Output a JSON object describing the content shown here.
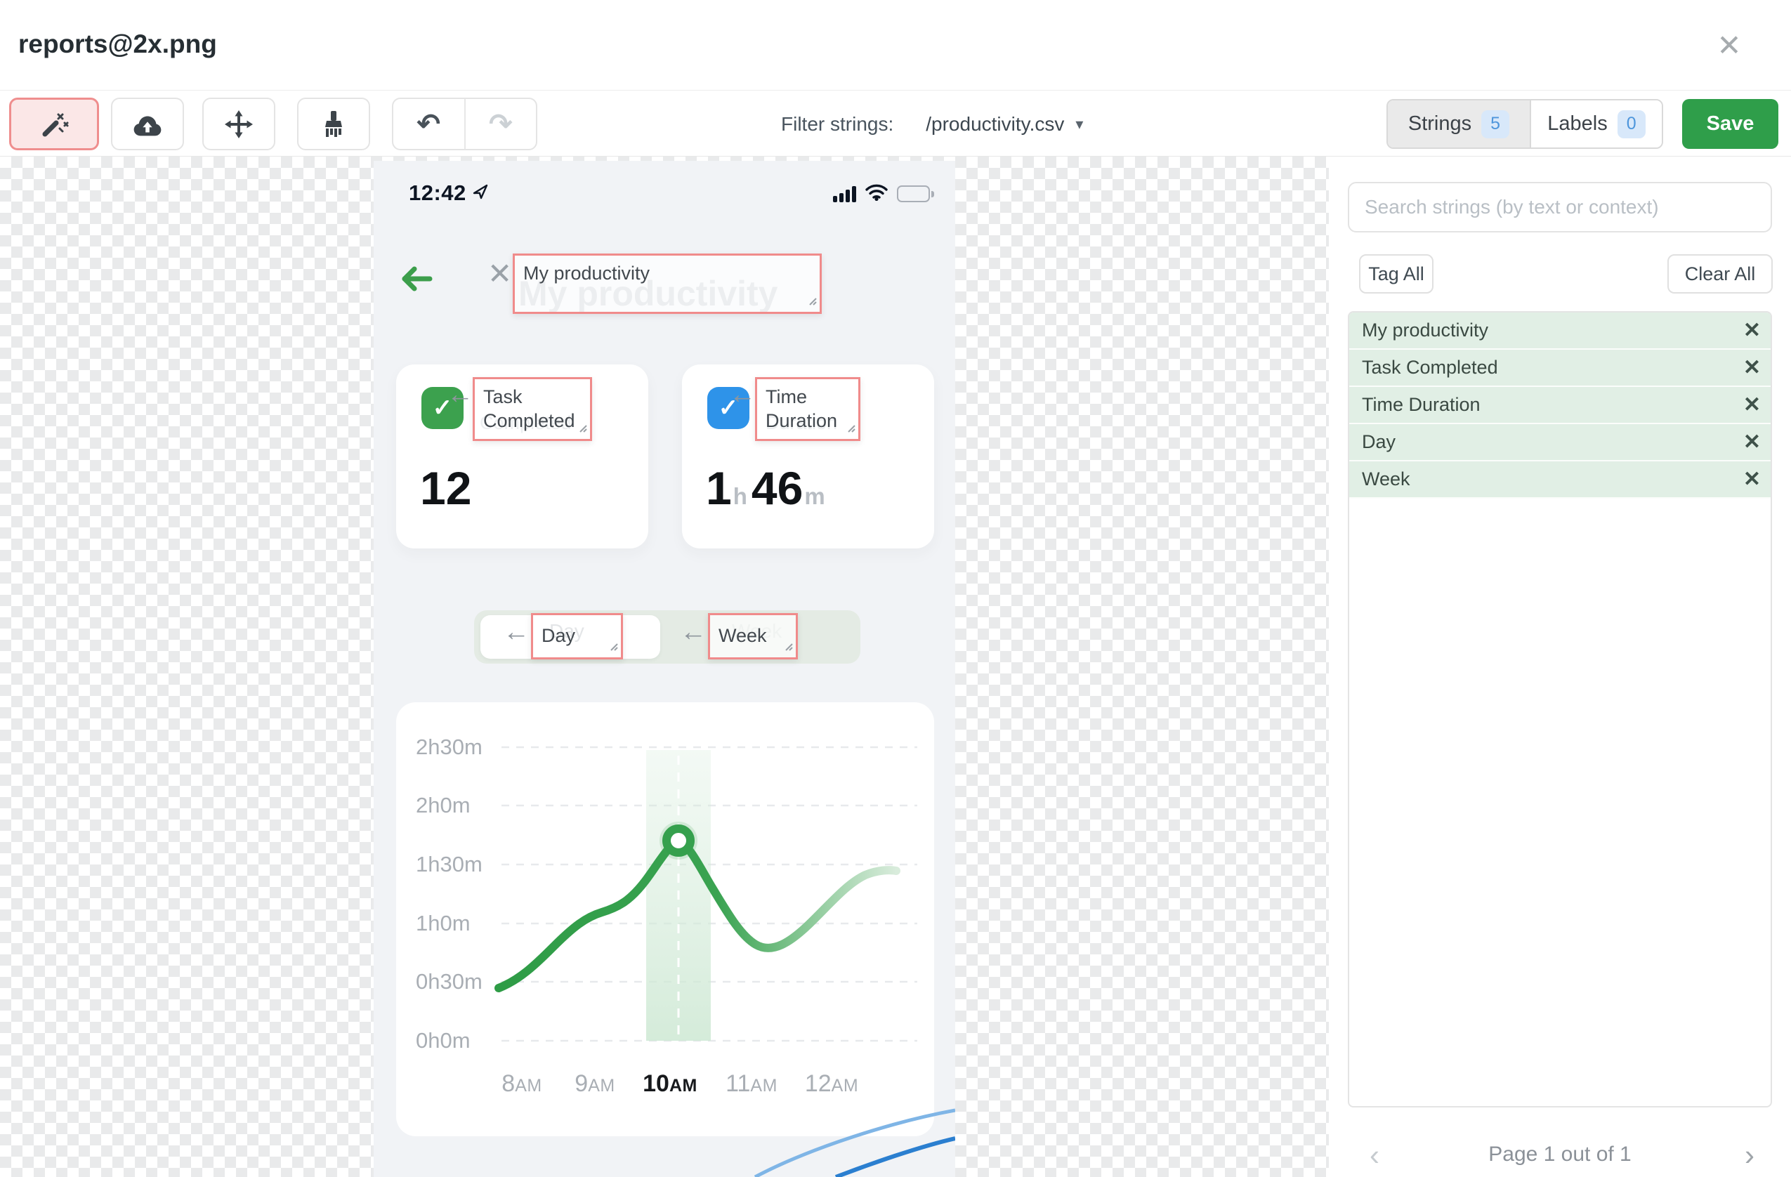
{
  "header": {
    "title": "reports@2x.png"
  },
  "toolbar": {
    "filter_label": "Filter strings:",
    "filter_value": "/productivity.csv",
    "strings_tab": "Strings",
    "strings_count": "5",
    "labels_tab": "Labels",
    "labels_count": "0",
    "save": "Save"
  },
  "icons": {
    "close": "✕",
    "tag_close": "✕",
    "anchor_arrow": "←",
    "caret_down": "▾",
    "check": "✓",
    "chevron_left": "‹",
    "chevron_right": "›",
    "undo": "↶",
    "redo": "↷"
  },
  "phone": {
    "time": "12:42",
    "ghost_title": "My productivity",
    "ghost_task": "Completed",
    "ghost_time": "Duration",
    "ghost_day": "Day",
    "ghost_week": "Week",
    "task_value": "12",
    "time_h": "1",
    "time_h_unit": "h",
    "time_m": "46",
    "time_m_unit": "m"
  },
  "tags": {
    "title": "My productivity",
    "task_line1": "Task",
    "task_line2": "Completed",
    "time_line1": "Time",
    "time_line2": "Duration",
    "day": "Day",
    "week": "Week"
  },
  "chart_data": {
    "type": "line",
    "title": "",
    "categories": [
      "8AM",
      "9AM",
      "10AM",
      "11AM",
      "12AM"
    ],
    "x_ticks": [
      {
        "t": "8",
        "p": "AM"
      },
      {
        "t": "9",
        "p": "AM"
      },
      {
        "t": "10",
        "p": "AM"
      },
      {
        "t": "11",
        "p": "AM"
      },
      {
        "t": "12",
        "p": "AM"
      }
    ],
    "y_ticks": [
      "2h30m",
      "2h0m",
      "1h30m",
      "1h0m",
      "0h30m",
      "0h0m"
    ],
    "series": [
      {
        "name": "Time Duration",
        "values_minutes": [
          28,
          65,
          102,
          55,
          90
        ]
      }
    ],
    "highlighted_x": "10AM",
    "highlight_value": "1h 46m",
    "ylim_minutes": [
      0,
      150
    ],
    "grid": "dashed-horizontal",
    "legend": "none",
    "accent_color": "#2f9e47"
  },
  "sidebar": {
    "search_placeholder": "Search strings (by text or context)",
    "tag_all": "Tag All",
    "clear_all": "Clear All",
    "strings": [
      "My productivity",
      "Task Completed",
      "Time Duration",
      "Day",
      "Week"
    ],
    "pagination": "Page 1 out of 1"
  },
  "colors": {
    "accent_green": "#2f9e4a",
    "tag_red": "#ef8e8e",
    "badge_blue": "#4e96dc",
    "row_green": "#e1efe5",
    "blue_check": "#2e93e9"
  }
}
